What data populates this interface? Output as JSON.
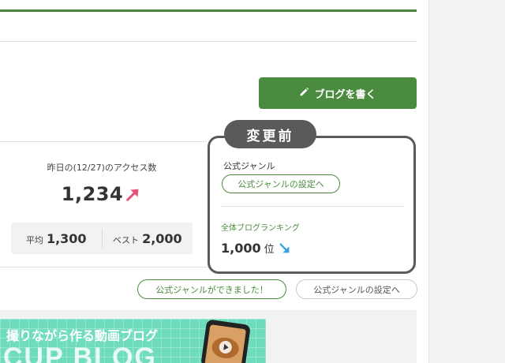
{
  "toolbar": {
    "write_blog_label": "ブログを書く"
  },
  "access": {
    "label": "昨日の(12/27)のアクセス数",
    "value": "1,234",
    "trend_icon": "up-right-arrow",
    "stats": [
      {
        "label": "平均",
        "value": "1,300"
      },
      {
        "label": "ベスト",
        "value": "2,000"
      }
    ]
  },
  "before_card": {
    "tag": "変更前",
    "official_genre_label": "公式ジャンル",
    "genre_setting_label": "公式ジャンルの設定へ",
    "ranking_label": "全体ブログランキング",
    "rank_value": "1,000",
    "rank_unit": "位",
    "rank_trend_icon": "down-right-arrow"
  },
  "actions": {
    "genre_ready_label": "公式ジャンルができました！",
    "genre_setting_label": "公式ジャンルの設定へ"
  },
  "banner": {
    "headline": "撮りながら作る動画ブログ",
    "logo": "CUP BLOG"
  },
  "colors": {
    "brand_green": "#4b8b3f",
    "card_border": "#5a5a5a",
    "up_arrow": "#e8537a",
    "down_arrow": "#3aa0e0",
    "banner_bg": "#6fdcbe"
  }
}
